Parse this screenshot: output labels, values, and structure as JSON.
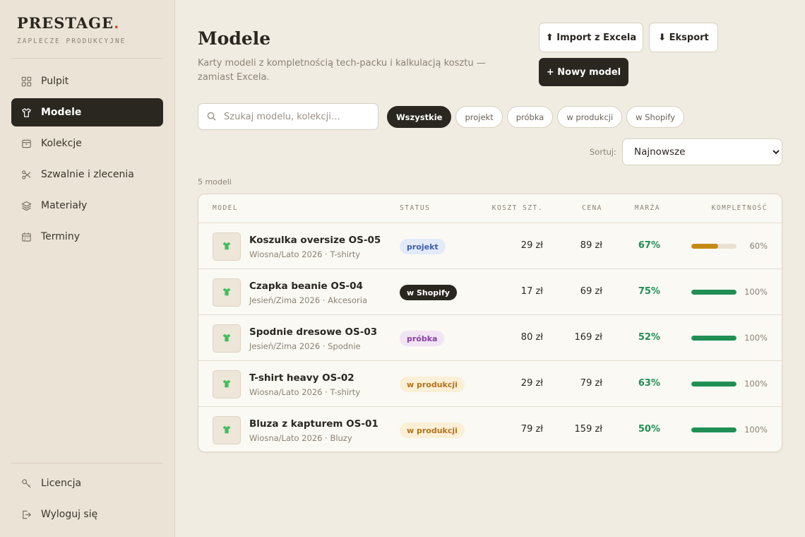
{
  "brand": {
    "name": "PRESTAGE",
    "dot": ".",
    "subtitle": "ZAPLECZE PRODUKCYJNE"
  },
  "nav": [
    {
      "label": "Pulpit",
      "icon": "grid-icon",
      "active": false
    },
    {
      "label": "Modele",
      "icon": "shirt-icon",
      "active": true
    },
    {
      "label": "Kolekcje",
      "icon": "archive-icon",
      "active": false
    },
    {
      "label": "Szwalnie i zlecenia",
      "icon": "scissors-icon",
      "active": false
    },
    {
      "label": "Materiały",
      "icon": "layers-icon",
      "active": false
    },
    {
      "label": "Terminy",
      "icon": "calendar-icon",
      "active": false
    }
  ],
  "nav_bottom": [
    {
      "label": "Licencja",
      "icon": "key-icon"
    },
    {
      "label": "Wyloguj się",
      "icon": "logout-icon"
    }
  ],
  "page": {
    "title": "Modele",
    "description": "Karty modeli z kompletnością tech-packu i kalkulacją kosztu — zamiast Excela."
  },
  "actions": {
    "import_label": "⬆ Import z Excela",
    "export_label": "⬇ Eksport",
    "new_label": "+ Nowy model"
  },
  "search": {
    "placeholder": "Szukaj modelu, kolekcji…"
  },
  "filters": [
    "Wszystkie",
    "projekt",
    "próbka",
    "w produkcji",
    "w Shopify"
  ],
  "active_filter": "Wszystkie",
  "sort": {
    "label": "Sortuj:",
    "selected": "Najnowsze"
  },
  "count_label": "5 modeli",
  "columns": {
    "model": "MODEL",
    "status": "STATUS",
    "cost": "KOSZT SZT.",
    "price": "CENA",
    "margin": "MARŻA",
    "completeness": "KOMPLETNOŚĆ"
  },
  "status_colors": {
    "projekt": {
      "bg": "#e3ebfa",
      "fg": "#3d5fb0"
    },
    "w Shopify": {
      "bg": "#2a2620",
      "fg": "#ffffff"
    },
    "próbka": {
      "bg": "#f1e4f5",
      "fg": "#8a3fa3"
    },
    "w produkcji": {
      "bg": "#fbefd6",
      "fg": "#b3731a"
    }
  },
  "progress_colors": {
    "partial": "#c48a18",
    "complete": "#1f8f55"
  },
  "rows": [
    {
      "name": "Koszulka oversize OS-05",
      "sub": "Wiosna/Lato 2026 · T-shirty",
      "status": "projekt",
      "cost": "29 zł",
      "price": "89 zł",
      "margin": "67%",
      "completeness": 60,
      "pct": "60%"
    },
    {
      "name": "Czapka beanie OS-04",
      "sub": "Jesień/Zima 2026 · Akcesoria",
      "status": "w Shopify",
      "cost": "17 zł",
      "price": "69 zł",
      "margin": "75%",
      "completeness": 100,
      "pct": "100%"
    },
    {
      "name": "Spodnie dresowe OS-03",
      "sub": "Jesień/Zima 2026 · Spodnie",
      "status": "próbka",
      "cost": "80 zł",
      "price": "169 zł",
      "margin": "52%",
      "completeness": 100,
      "pct": "100%"
    },
    {
      "name": "T-shirt heavy OS-02",
      "sub": "Wiosna/Lato 2026 · T-shirty",
      "status": "w produkcji",
      "cost": "29 zł",
      "price": "79 zł",
      "margin": "63%",
      "completeness": 100,
      "pct": "100%"
    },
    {
      "name": "Bluza z kapturem OS-01",
      "sub": "Wiosna/Lato 2026 · Bluzy",
      "status": "w produkcji",
      "cost": "79 zł",
      "price": "159 zł",
      "margin": "50%",
      "completeness": 100,
      "pct": "100%"
    }
  ]
}
